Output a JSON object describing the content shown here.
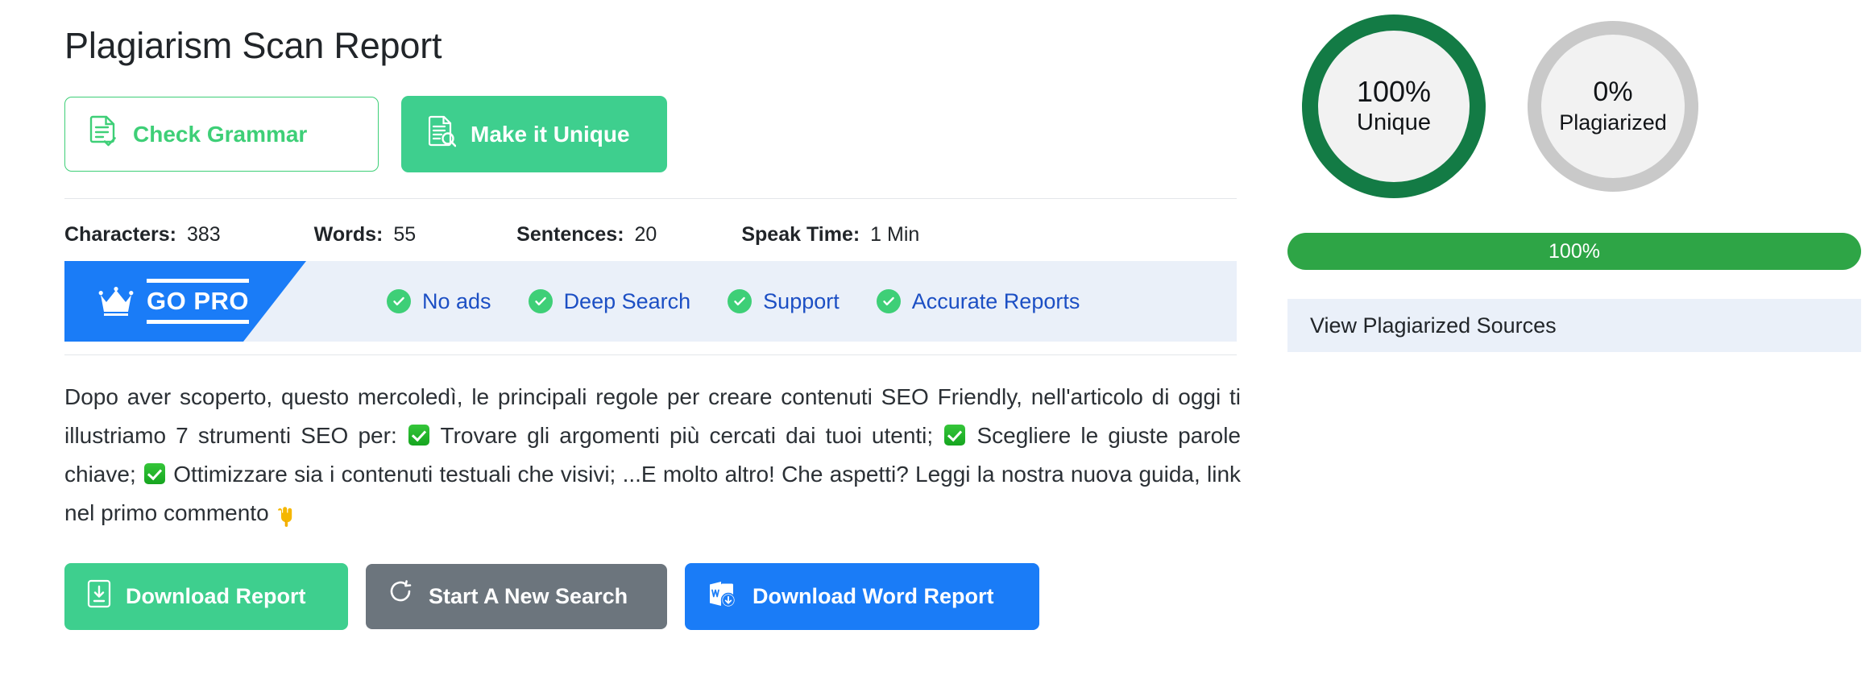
{
  "header": {
    "title": "Plagiarism Scan Report"
  },
  "actions": {
    "check_grammar_label": "Check Grammar",
    "make_unique_label": "Make it Unique"
  },
  "stats": [
    {
      "label": "Characters:",
      "value": "383"
    },
    {
      "label": "Words:",
      "value": "55"
    },
    {
      "label": "Sentences:",
      "value": "20"
    },
    {
      "label": "Speak Time:",
      "value": "1 Min"
    }
  ],
  "gopro": {
    "tag_label": "GO PRO",
    "features": [
      {
        "label": "No ads"
      },
      {
        "label": "Deep Search"
      },
      {
        "label": "Support"
      },
      {
        "label": "Accurate Reports"
      }
    ]
  },
  "report_text": {
    "part1": "Dopo aver scoperto, questo mercoledì, le principali regole per creare contenuti SEO Friendly, nell'articolo di oggi ti illustriamo 7 strumenti SEO per:",
    "part2": "Trovare gli argomenti più cercati dai tuoi utenti;",
    "part3": "Scegliere le giuste parole chiave;",
    "part4": "Ottimizzare sia i contenuti testuali che visivi; ...E molto altro! Che aspetti? Leggi la nostra nuova guida, link nel primo commento"
  },
  "bottom_buttons": {
    "download_report_label": "Download Report",
    "new_search_label": "Start A New Search",
    "word_report_label": "Download Word Report"
  },
  "results": {
    "unique": {
      "percent": "100%",
      "label": "Unique"
    },
    "plagiarized": {
      "percent": "0%",
      "label": "Plagiarized"
    },
    "progress_label": "100%",
    "sources_label": "View Plagiarized Sources"
  },
  "colors": {
    "green_accent": "#3ecf8e",
    "dark_green": "#137b45",
    "blue_accent": "#1a7cf7",
    "link_blue": "#1c4fc4",
    "gray_button": "#6c757d",
    "progress_green": "#2ea546",
    "panel_blue_gray": "#eaf0f9"
  }
}
